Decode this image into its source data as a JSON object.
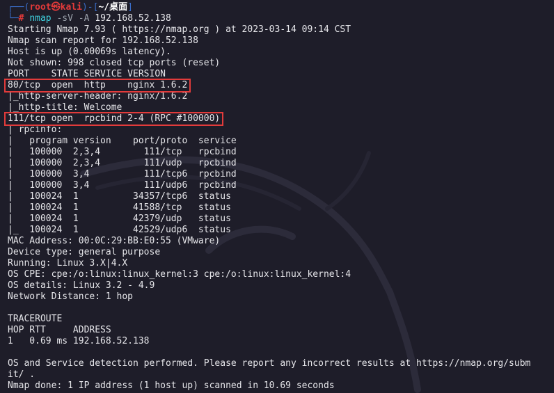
{
  "prompt": {
    "open": "┌──(",
    "user": "root㉿kali",
    "mid": ")-[",
    "path": "~/桌面",
    "close": "]",
    "arrow": "└─",
    "hash": "#",
    "cmd": "nmap",
    "args": " -sV -A",
    "target": " 192.168.52.138"
  },
  "output": [
    "Starting Nmap 7.93 ( https://nmap.org ) at 2023-03-14 09:14 CST",
    "Nmap scan report for 192.168.52.138",
    "Host is up (0.00069s latency).",
    "Not shown: 998 closed tcp ports (reset)",
    "PORT    STATE SERVICE VERSION",
    "80/tcp  open  http    nginx 1.6.2",
    "|_http-server-header: nginx/1.6.2",
    "|_http-title: Welcome",
    "111/tcp open  rpcbind 2-4 (RPC #100000)",
    "| rpcinfo:",
    "|   program version    port/proto  service",
    "|   100000  2,3,4        111/tcp   rpcbind",
    "|   100000  2,3,4        111/udp   rpcbind",
    "|   100000  3,4          111/tcp6  rpcbind",
    "|   100000  3,4          111/udp6  rpcbind",
    "|   100024  1          34357/tcp6  status",
    "|   100024  1          41588/tcp   status",
    "|   100024  1          42379/udp   status",
    "|_  100024  1          42529/udp6  status",
    "MAC Address: 00:0C:29:BB:E0:55 (VMware)",
    "Device type: general purpose",
    "Running: Linux 3.X|4.X",
    "OS CPE: cpe:/o:linux:linux_kernel:3 cpe:/o:linux:linux_kernel:4",
    "OS details: Linux 3.2 - 4.9",
    "Network Distance: 1 hop",
    "",
    "TRACEROUTE",
    "HOP RTT     ADDRESS",
    "1   0.69 ms 192.168.52.138",
    "",
    "OS and Service detection performed. Please report any incorrect results at https://nmap.org/subm",
    "it/ .",
    "Nmap done: 1 IP address (1 host up) scanned in 10.69 seconds"
  ],
  "highlighted_lines": [
    5,
    8
  ],
  "colors": {
    "background": "#1e1d29",
    "text": "#e6e6ea",
    "highlight_box": "#e23b3b",
    "prompt_bracket": "#3a6cc7",
    "prompt_user": "#e33a3a",
    "command": "#3fd3e0"
  }
}
